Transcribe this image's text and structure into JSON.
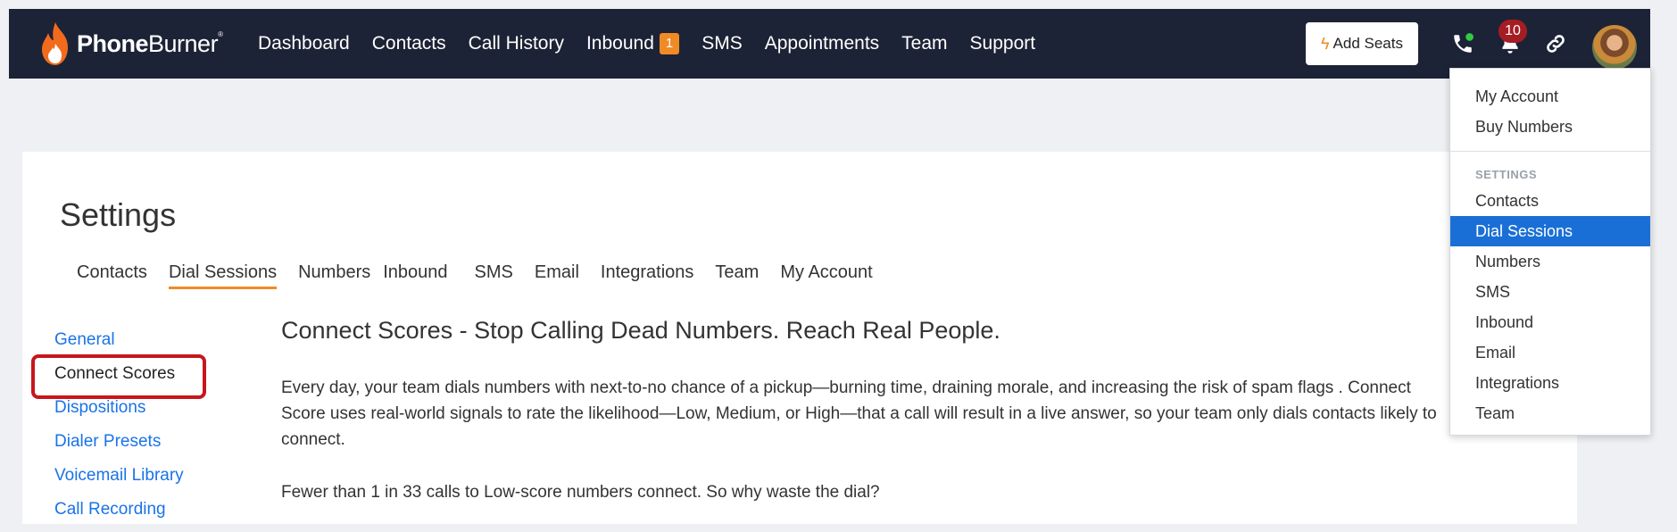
{
  "brand": {
    "name_bold": "Phone",
    "name_light": "Burner",
    "trademark": "®"
  },
  "nav": [
    {
      "label": "Dashboard"
    },
    {
      "label": "Contacts"
    },
    {
      "label": "Call History"
    },
    {
      "label": "Inbound",
      "badge": "1"
    },
    {
      "label": "SMS"
    },
    {
      "label": "Appointments"
    },
    {
      "label": "Team"
    },
    {
      "label": "Support"
    }
  ],
  "header_actions": {
    "add_seats": "Add Seats",
    "notifications_count": "10"
  },
  "settings": {
    "title": "Settings",
    "tabs": [
      "Contacts",
      "Dial Sessions",
      "Numbers",
      "Inbound",
      "SMS",
      "Email",
      "Integrations",
      "Team",
      "My Account"
    ],
    "active_tab": "Dial Sessions",
    "sidenav": [
      "General",
      "Connect Scores",
      "Dispositions",
      "Dialer Presets",
      "Voicemail Library",
      "Call Recording"
    ],
    "active_side": "Connect Scores"
  },
  "content": {
    "heading": "Connect Scores - Stop Calling Dead Numbers. Reach Real People.",
    "paragraph1": "Every day, your team dials numbers with next-to-no chance of a pickup—burning time, draining morale, and increasing the risk of spam flags . Connect Score uses real-world signals to rate the likelihood—Low, Medium, or High—that a call will result in a live answer, so your team only dials contacts likely to connect.",
    "paragraph2": "Fewer than 1 in 33 calls to Low-score numbers connect. So why waste the dial?"
  },
  "dropdown": {
    "top_items": [
      "My Account",
      "Buy Numbers"
    ],
    "section_header": "SETTINGS",
    "settings_items": [
      "Contacts",
      "Dial Sessions",
      "Numbers",
      "SMS",
      "Inbound",
      "Email",
      "Integrations",
      "Team"
    ],
    "active_item": "Dial Sessions"
  },
  "colors": {
    "nav_bg": "#1d2336",
    "accent_orange": "#f08a24",
    "link_blue": "#1a73e8",
    "highlight_red": "#c7161c",
    "dropdown_active": "#1a6fd6"
  },
  "icons": [
    "flame-logo-icon",
    "bolt-icon",
    "phone-icon",
    "bell-icon",
    "link-icon"
  ]
}
